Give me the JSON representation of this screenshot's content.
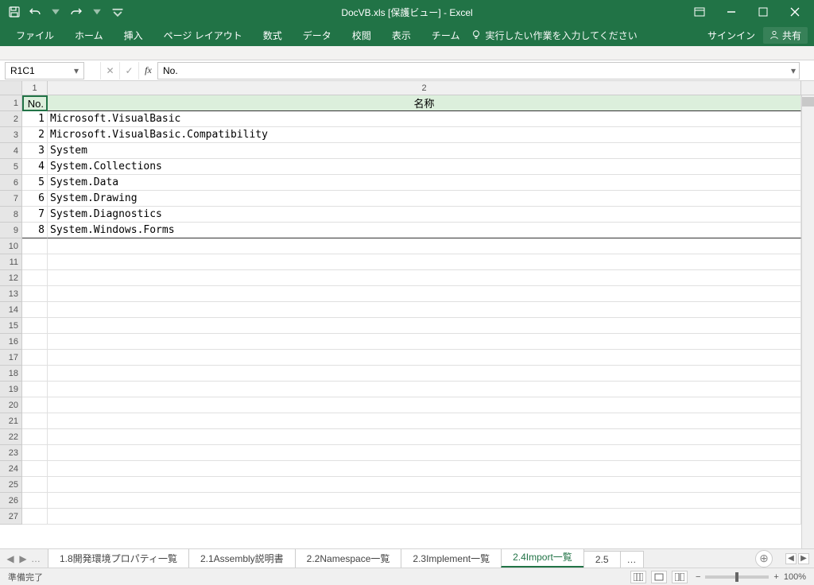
{
  "title": "DocVB.xls  [保護ビュー] - Excel",
  "ribbon": {
    "file": "ファイル",
    "home": "ホーム",
    "insert": "挿入",
    "page_layout": "ページ レイアウト",
    "formulas": "数式",
    "data": "データ",
    "review": "校閲",
    "view": "表示",
    "team": "チーム",
    "tell_me": "実行したい作業を入力してください",
    "signin": "サインイン",
    "share": "共有"
  },
  "name_box": "R1C1",
  "formula_value": "No.",
  "columns": {
    "c1": "1",
    "c2": "2"
  },
  "headers": {
    "no": "No.",
    "name": "名称"
  },
  "rows": [
    {
      "n": 1,
      "no": "1",
      "name": "Microsoft.VisualBasic"
    },
    {
      "n": 2,
      "no": "2",
      "name": "Microsoft.VisualBasic.Compatibility"
    },
    {
      "n": 3,
      "no": "3",
      "name": "System"
    },
    {
      "n": 4,
      "no": "4",
      "name": "System.Collections"
    },
    {
      "n": 5,
      "no": "5",
      "name": "System.Data"
    },
    {
      "n": 6,
      "no": "6",
      "name": "System.Drawing"
    },
    {
      "n": 7,
      "no": "7",
      "name": "System.Diagnostics"
    },
    {
      "n": 8,
      "no": "8",
      "name": "System.Windows.Forms"
    }
  ],
  "empty_rows": [
    10,
    11,
    12,
    13,
    14,
    15,
    16,
    17,
    18,
    19,
    20,
    21,
    22,
    23,
    24,
    25,
    26,
    27
  ],
  "sheet_tabs": {
    "t1": "1.8開発環境プロパティ一覧",
    "t2": "2.1Assembly説明書",
    "t3": "2.2Namespace一覧",
    "t4": "2.3Implement一覧",
    "t5": "2.4Import一覧",
    "t6": "2.5"
  },
  "status": {
    "ready": "準備完了",
    "zoom": "100%"
  }
}
